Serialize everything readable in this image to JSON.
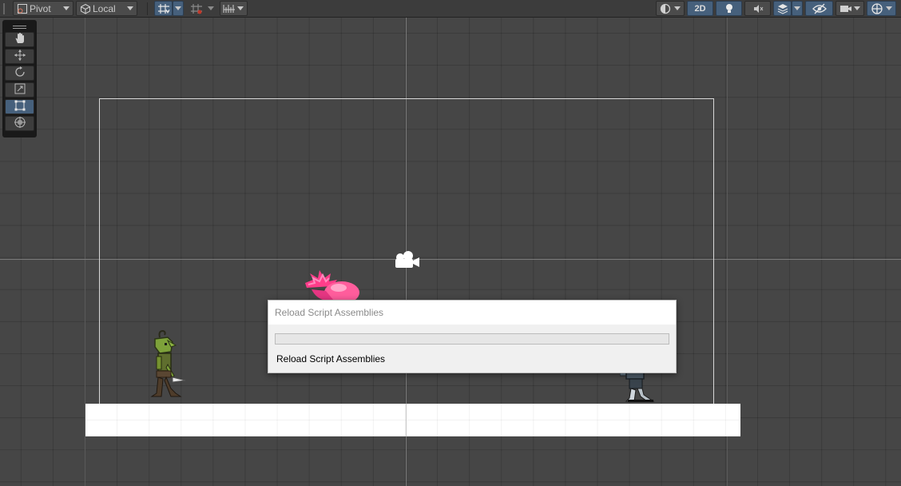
{
  "toolbar": {
    "pivot_label": "Pivot",
    "space_label": "Local",
    "mode_2d_label": "2D",
    "icons": [
      "pivot-icon",
      "local-cube-icon",
      "grid-snap-icon",
      "increment-snap-icon",
      "ruler-icon",
      "draw-mode-icon",
      "light-icon",
      "audio-mute-icon",
      "effects-icon",
      "visibility-icon",
      "camera-icon",
      "gizmos-icon"
    ]
  },
  "tools": {
    "items": [
      "hand-tool",
      "move-tool",
      "rotate-tool",
      "scale-tool",
      "rect-tool",
      "transform-tool"
    ],
    "active": "rect-tool"
  },
  "dialog": {
    "title": "Reload Script Assemblies",
    "message": "Reload Script Assemblies",
    "progress": 0
  },
  "colors": {
    "scene_background": "#464646",
    "toolbar_background": "#3c3c3c",
    "active_button": "#46607c",
    "ground": "#ffffff",
    "dialog_background": "#f0f0f0"
  }
}
